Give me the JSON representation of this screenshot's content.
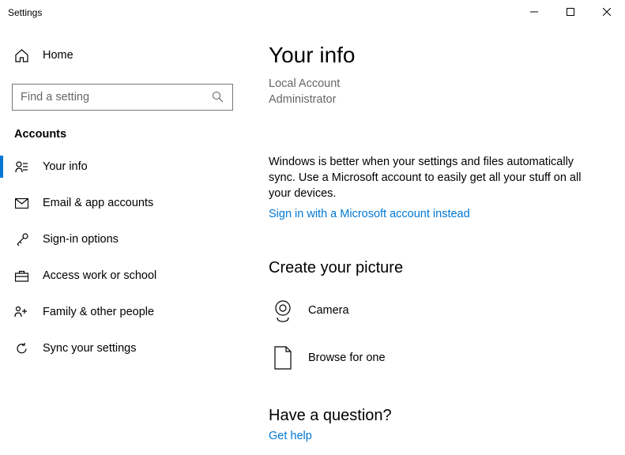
{
  "window": {
    "title": "Settings"
  },
  "sidebar": {
    "home_label": "Home",
    "search_placeholder": "Find a setting",
    "section_header": "Accounts",
    "items": [
      {
        "label": "Your info"
      },
      {
        "label": "Email & app accounts"
      },
      {
        "label": "Sign-in options"
      },
      {
        "label": "Access work or school"
      },
      {
        "label": "Family & other people"
      },
      {
        "label": "Sync your settings"
      }
    ]
  },
  "main": {
    "title": "Your info",
    "account_type": "Local Account",
    "role": "Administrator",
    "sync_text": "Windows is better when your settings and files automatically sync. Use a Microsoft account to easily get all your stuff on all your devices.",
    "signin_link": "Sign in with a Microsoft account instead",
    "picture_heading": "Create your picture",
    "camera_label": "Camera",
    "browse_label": "Browse for one",
    "question_heading": "Have a question?",
    "gethelp_link": "Get help"
  }
}
